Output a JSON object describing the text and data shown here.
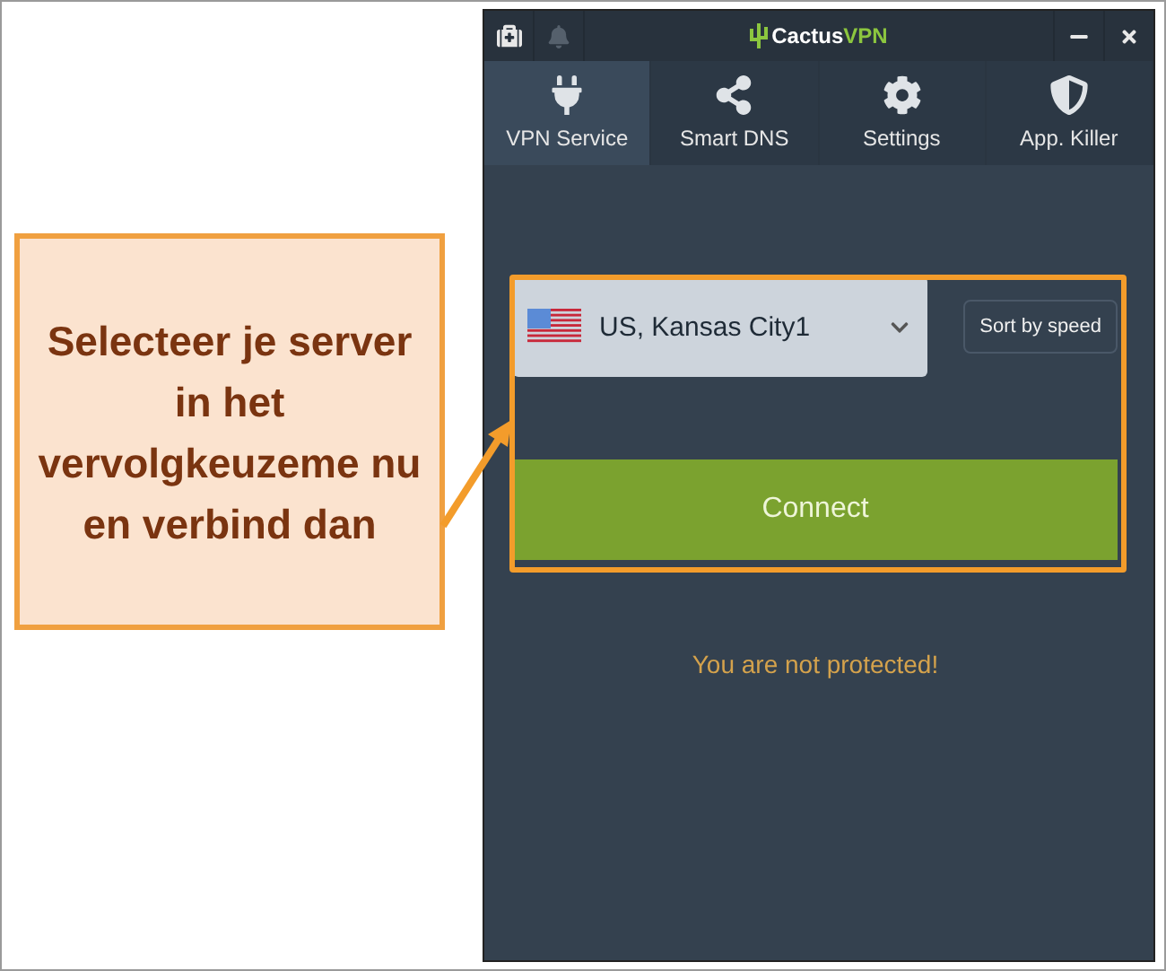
{
  "callout": {
    "text": "Selecteer je server in het vervolgkeuzeme nu en verbind dan"
  },
  "window": {
    "logo": {
      "name": "Cactus",
      "suffix": "VPN"
    },
    "controls": [
      {
        "kind": "minimize"
      },
      {
        "kind": "close"
      }
    ]
  },
  "tabs": [
    {
      "label": "VPN Service",
      "kind": "plug",
      "selected": true
    },
    {
      "label": "Smart DNS",
      "kind": "share",
      "selected": false
    },
    {
      "label": "Settings",
      "kind": "gear",
      "selected": false
    },
    {
      "label": "App. Killer",
      "kind": "shield",
      "selected": false
    }
  ],
  "server": {
    "value": "US, Kansas City1"
  },
  "sort": {
    "label": "Sort by speed"
  },
  "connect": {
    "label": "Connect"
  },
  "status": "You are not protected!"
}
